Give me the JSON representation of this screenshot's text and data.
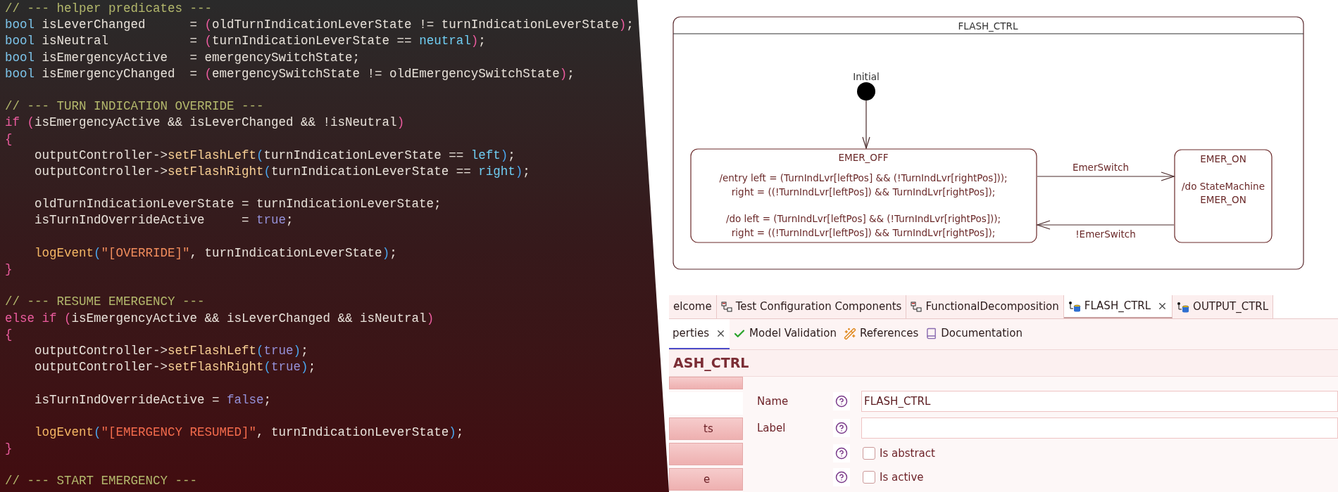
{
  "code_editor": {
    "lines": [
      {
        "kind": "code",
        "tokens": [
          {
            "kind": "comment",
            "text": "// --- helper predicates ---"
          }
        ]
      },
      {
        "kind": "code",
        "tokens": [
          {
            "kind": "type",
            "text": "bool"
          },
          {
            "kind": "plain",
            "text": " isLeverChanged      = "
          },
          {
            "kind": "paren",
            "text": "("
          },
          {
            "kind": "plain",
            "text": "oldTurnIndicationLeverState != turnIndicationLeverState"
          },
          {
            "kind": "paren",
            "text": ")"
          },
          {
            "kind": "plain",
            "text": ";"
          }
        ]
      },
      {
        "kind": "code",
        "tokens": [
          {
            "kind": "type",
            "text": "bool"
          },
          {
            "kind": "plain",
            "text": " isNeutral           = "
          },
          {
            "kind": "paren",
            "text": "("
          },
          {
            "kind": "plain",
            "text": "turnIndicationLeverState == "
          },
          {
            "kind": "enum",
            "text": "neutral"
          },
          {
            "kind": "paren",
            "text": ")"
          },
          {
            "kind": "plain",
            "text": ";"
          }
        ]
      },
      {
        "kind": "code",
        "tokens": [
          {
            "kind": "type",
            "text": "bool"
          },
          {
            "kind": "plain",
            "text": " isEmergencyActive   = emergencySwitchState;"
          }
        ]
      },
      {
        "kind": "code",
        "tokens": [
          {
            "kind": "type",
            "text": "bool"
          },
          {
            "kind": "plain",
            "text": " isEmergencyChanged  = "
          },
          {
            "kind": "paren",
            "text": "("
          },
          {
            "kind": "plain",
            "text": "emergencySwitchState != oldEmergencySwitchState"
          },
          {
            "kind": "paren",
            "text": ")"
          },
          {
            "kind": "plain",
            "text": ";"
          }
        ]
      },
      {
        "kind": "blank"
      },
      {
        "kind": "code",
        "tokens": [
          {
            "kind": "comment",
            "text": "// --- TURN INDICATION OVERRIDE ---"
          }
        ]
      },
      {
        "kind": "code",
        "tokens": [
          {
            "kind": "keyword",
            "text": "if "
          },
          {
            "kind": "paren",
            "text": "("
          },
          {
            "kind": "plain",
            "text": "isEmergencyActive && isLeverChanged && !isNeutral"
          },
          {
            "kind": "paren",
            "text": ")"
          }
        ]
      },
      {
        "kind": "code",
        "tokens": [
          {
            "kind": "paren",
            "text": "{"
          }
        ]
      },
      {
        "kind": "code",
        "tokens": [
          {
            "kind": "plain",
            "text": "    outputController->"
          },
          {
            "kind": "method",
            "text": "setFlashLeft"
          },
          {
            "kind": "callparen",
            "text": "("
          },
          {
            "kind": "plain",
            "text": "turnIndicationLeverState == "
          },
          {
            "kind": "enum",
            "text": "left"
          },
          {
            "kind": "callparen",
            "text": ")"
          },
          {
            "kind": "plain",
            "text": ";"
          }
        ]
      },
      {
        "kind": "code",
        "tokens": [
          {
            "kind": "plain",
            "text": "    outputController->"
          },
          {
            "kind": "method",
            "text": "setFlashRight"
          },
          {
            "kind": "callparen",
            "text": "("
          },
          {
            "kind": "plain",
            "text": "turnIndicationLeverState == "
          },
          {
            "kind": "enum",
            "text": "right"
          },
          {
            "kind": "callparen",
            "text": ")"
          },
          {
            "kind": "plain",
            "text": ";"
          }
        ]
      },
      {
        "kind": "blank"
      },
      {
        "kind": "code",
        "tokens": [
          {
            "kind": "plain",
            "text": "    oldTurnIndicationLeverState = turnIndicationLeverState;"
          }
        ]
      },
      {
        "kind": "code",
        "tokens": [
          {
            "kind": "plain",
            "text": "    isTurnIndOverrideActive     = "
          },
          {
            "kind": "bool",
            "text": "true"
          },
          {
            "kind": "plain",
            "text": ";"
          }
        ]
      },
      {
        "kind": "blank"
      },
      {
        "kind": "code",
        "tokens": [
          {
            "kind": "function",
            "text": "    logEvent"
          },
          {
            "kind": "callparen",
            "text": "("
          },
          {
            "kind": "string",
            "text": "\"[OVERRIDE]\""
          },
          {
            "kind": "plain",
            "text": ", turnIndicationLeverState"
          },
          {
            "kind": "callparen",
            "text": ")"
          },
          {
            "kind": "plain",
            "text": ";"
          }
        ]
      },
      {
        "kind": "code",
        "tokens": [
          {
            "kind": "paren",
            "text": "}"
          }
        ]
      },
      {
        "kind": "blank"
      },
      {
        "kind": "code",
        "tokens": [
          {
            "kind": "comment",
            "text": "// --- RESUME EMERGENCY ---"
          }
        ]
      },
      {
        "kind": "code",
        "tokens": [
          {
            "kind": "keyword",
            "text": "else if "
          },
          {
            "kind": "paren",
            "text": "("
          },
          {
            "kind": "plain",
            "text": "isEmergencyActive && isLeverChanged && isNeutral"
          },
          {
            "kind": "paren",
            "text": ")"
          }
        ]
      },
      {
        "kind": "code",
        "tokens": [
          {
            "kind": "paren",
            "text": "{"
          }
        ]
      },
      {
        "kind": "code",
        "tokens": [
          {
            "kind": "plain",
            "text": "    outputController->"
          },
          {
            "kind": "method",
            "text": "setFlashLeft"
          },
          {
            "kind": "callparen",
            "text": "("
          },
          {
            "kind": "bool",
            "text": "true"
          },
          {
            "kind": "callparen",
            "text": ")"
          },
          {
            "kind": "plain",
            "text": ";"
          }
        ]
      },
      {
        "kind": "code",
        "tokens": [
          {
            "kind": "plain",
            "text": "    outputController->"
          },
          {
            "kind": "method",
            "text": "setFlashRight"
          },
          {
            "kind": "callparen",
            "text": "("
          },
          {
            "kind": "bool",
            "text": "true"
          },
          {
            "kind": "callparen",
            "text": ")"
          },
          {
            "kind": "plain",
            "text": ";"
          }
        ]
      },
      {
        "kind": "blank"
      },
      {
        "kind": "code",
        "tokens": [
          {
            "kind": "plain",
            "text": "    isTurnIndOverrideActive = "
          },
          {
            "kind": "bool",
            "text": "false"
          },
          {
            "kind": "plain",
            "text": ";"
          }
        ]
      },
      {
        "kind": "blank"
      },
      {
        "kind": "code",
        "tokens": [
          {
            "kind": "function",
            "text": "    logEvent"
          },
          {
            "kind": "callparen",
            "text": "("
          },
          {
            "kind": "string2",
            "text": "\"[EMERGENCY RESUMED]\""
          },
          {
            "kind": "plain",
            "text": ", turnIndicationLeverState"
          },
          {
            "kind": "callparen",
            "text": ")"
          },
          {
            "kind": "plain",
            "text": ";"
          }
        ]
      },
      {
        "kind": "code",
        "tokens": [
          {
            "kind": "paren",
            "text": "}"
          }
        ]
      },
      {
        "kind": "blank"
      },
      {
        "kind": "code",
        "tokens": [
          {
            "kind": "comment",
            "text": "// --- START EMERGENCY ---"
          }
        ]
      }
    ]
  },
  "diagram": {
    "title": "FLASH_CTRL",
    "initial_label": "Initial",
    "states": [
      {
        "name": "EMER_OFF",
        "sections": [
          [
            "/entry left = (TurnIndLvr[leftPos] && (!TurnIndLvr[rightPos]));",
            "right = ((!TurnIndLvr[leftPos]) && TurnIndLvr[rightPos]);"
          ],
          [
            "/do left = (TurnIndLvr[leftPos] && (!TurnIndLvr[rightPos]));",
            "right = ((!TurnIndLvr[leftPos]) && TurnIndLvr[rightPos]);"
          ]
        ]
      },
      {
        "name": "EMER_ON",
        "sections": [
          [
            "/do StateMachine",
            "EMER_ON"
          ]
        ]
      }
    ],
    "transitions": [
      {
        "label": "EmerSwitch"
      },
      {
        "label": "!EmerSwitch"
      }
    ]
  },
  "editor_tabs": [
    {
      "label": "elcome",
      "selected": false,
      "closable": false
    },
    {
      "label": "Test Configuration Components",
      "kind": "diagram",
      "selected": false,
      "closable": false
    },
    {
      "label": "FunctionalDecomposition",
      "kind": "diagram",
      "selected": false,
      "closable": false
    },
    {
      "label": "FLASH_CTRL",
      "kind": "state_machine",
      "selected": true,
      "closable": true
    },
    {
      "label": "OUTPUT_CTRL",
      "kind": "state_machine",
      "selected": false,
      "closable": false
    }
  ],
  "view_tabs": [
    {
      "label": "perties",
      "selected": true,
      "closable": true
    },
    {
      "label": "Model Validation",
      "kind": "validation",
      "selected": false,
      "closable": false
    },
    {
      "label": "References",
      "kind": "references",
      "selected": false,
      "closable": false
    },
    {
      "label": "Documentation",
      "kind": "documentation",
      "selected": false,
      "closable": false
    }
  ],
  "properties": {
    "title": "ASH_CTRL",
    "sidebar": [
      {
        "selected": false
      },
      {
        "selected": true
      },
      {
        "label": "ts",
        "selected": false
      },
      {
        "selected": false
      },
      {
        "label": "e",
        "selected": false
      }
    ],
    "fields": [
      {
        "kind": "text",
        "label": "Name",
        "value": "FLASH_CTRL"
      },
      {
        "kind": "text",
        "label": "Label"
      },
      {
        "kind": "checkbox",
        "label": "Is abstract",
        "checked": false
      },
      {
        "kind": "checkbox",
        "label": "Is active",
        "checked": false
      }
    ]
  }
}
